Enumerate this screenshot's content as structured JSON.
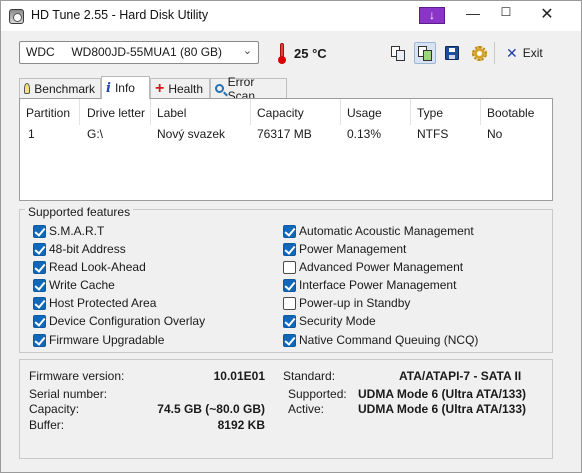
{
  "window": {
    "title": "HD Tune 2.55 - Hard Disk Utility"
  },
  "toolbar": {
    "drive_label": "WDC     WD800JD-55MUA1 (80 GB)",
    "temperature": "25 °C",
    "exit_label": "Exit",
    "icons": [
      "copy-text-icon",
      "copy-screenshot-icon",
      "save-icon",
      "options-icon"
    ]
  },
  "tabs": [
    {
      "label": "Benchmark",
      "icon": "bulb-icon"
    },
    {
      "label": "Info",
      "icon": "info-icon",
      "active": true
    },
    {
      "label": "Health",
      "icon": "health-cross-icon"
    },
    {
      "label": "Error Scan",
      "icon": "magnifier-icon"
    }
  ],
  "partitions": {
    "headers": [
      "Partition",
      "Drive letter",
      "Label",
      "Capacity",
      "Usage",
      "Type",
      "Bootable"
    ],
    "rows": [
      [
        "1",
        "G:\\",
        "Nový svazek",
        "76317 MB",
        "0.13%",
        "NTFS",
        "No"
      ]
    ]
  },
  "features": {
    "title": "Supported features",
    "left": [
      {
        "label": "S.M.A.R.T",
        "checked": true
      },
      {
        "label": "48-bit Address",
        "checked": true
      },
      {
        "label": "Read Look-Ahead",
        "checked": true
      },
      {
        "label": "Write Cache",
        "checked": true
      },
      {
        "label": "Host Protected Area",
        "checked": true
      },
      {
        "label": "Device Configuration Overlay",
        "checked": true
      },
      {
        "label": "Firmware Upgradable",
        "checked": true
      }
    ],
    "right": [
      {
        "label": "Automatic Acoustic Management",
        "checked": true
      },
      {
        "label": "Power Management",
        "checked": true
      },
      {
        "label": "Advanced Power Management",
        "checked": false
      },
      {
        "label": "Interface Power Management",
        "checked": true
      },
      {
        "label": "Power-up in Standby",
        "checked": false
      },
      {
        "label": "Security Mode",
        "checked": true
      },
      {
        "label": "Native Command Queuing (NCQ)",
        "checked": true
      }
    ]
  },
  "info": {
    "firmware_label": "Firmware version:",
    "firmware": "10.01E01",
    "serial_label": "Serial number:",
    "serial": "",
    "capacity_label": "Capacity:",
    "capacity": "74.5 GB (~80.0 GB)",
    "buffer_label": "Buffer:",
    "buffer": "8192 KB",
    "standard_label": "Standard:",
    "standard": "ATA/ATAPI-7 - SATA II",
    "supported_label": "Supported:",
    "supported": "UDMA Mode 6 (Ultra ATA/133)",
    "active_label": "Active:",
    "active": "UDMA Mode 6 (Ultra ATA/133)"
  },
  "colors": {
    "checkbox_checked": "#1167b8",
    "title_extra_button": "#8a35c8",
    "thermometer": "#d80000"
  }
}
